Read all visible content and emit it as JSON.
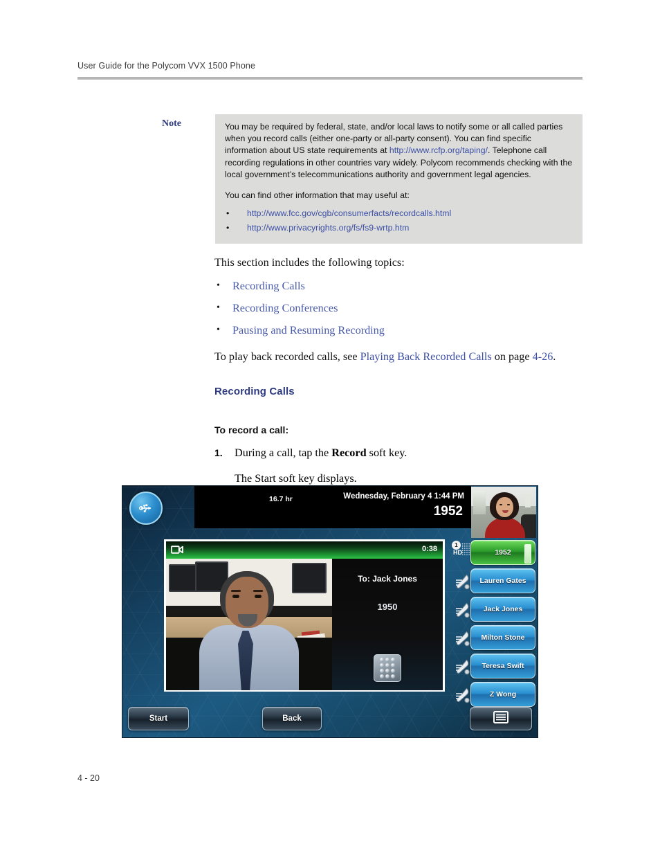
{
  "header": {
    "running_head": "User Guide for the Polycom VVX 1500 Phone"
  },
  "note": {
    "label": "Note",
    "paragraph1_part1": "You may be required by federal, state, and/or local laws to notify some or all called parties when you record calls (either one-party or all-party consent). You can find specific information about US state requirements at ",
    "paragraph1_link": "http://www.rcfp.org/taping/",
    "paragraph1_part2": ". Telephone call recording regulations in other countries vary widely. Polycom recommends checking with the local government’s telecommunications authority and government legal agencies.",
    "paragraph2": "You can find other information that may useful at:",
    "links": [
      "http://www.fcc.gov/cgb/consumerfacts/recordcalls.html",
      "http://www.privacyrights.org/fs/fs9-wrtp.htm"
    ]
  },
  "body": {
    "intro": "This section includes the following topics:",
    "topics": [
      "Recording Calls",
      "Recording Conferences",
      "Pausing and Resuming Recording"
    ],
    "playback_pre": "To play back recorded calls, see ",
    "playback_link": "Playing Back Recorded Calls",
    "playback_mid": " on page ",
    "playback_page": "4-26",
    "playback_post": ".",
    "section_heading": "Recording Calls",
    "procedure_heading": "To record a call:",
    "step1_number": "1.",
    "step1_pre": "During a call, tap the ",
    "step1_bold": "Record",
    "step1_post": " soft key.",
    "step1_result": "The Start soft key displays."
  },
  "phone": {
    "status": {
      "usb_icon": "usb-icon",
      "uptime": "16.7 hr",
      "datetime": "Wednesday, February 4  1:44 PM",
      "extension": "1952",
      "selfview_icon": "self-view-thumbnail"
    },
    "call": {
      "video_icon": "video-camera-icon",
      "duration": "0:38",
      "to_label": "To: Jack Jones",
      "to_number": "1950",
      "dialpad_icon": "dialpad-icon"
    },
    "line_keys": [
      {
        "label": "1952",
        "state": "active",
        "icon": "hd-audio-icon",
        "index_badge": "1",
        "hd_label": "HD"
      },
      {
        "label": "Lauren Gates",
        "state": "idle",
        "icon": "handset-icon"
      },
      {
        "label": "Jack Jones",
        "state": "idle",
        "icon": "handset-icon"
      },
      {
        "label": "Milton Stone",
        "state": "idle",
        "icon": "handset-icon"
      },
      {
        "label": "Teresa Swift",
        "state": "idle",
        "icon": "handset-icon"
      },
      {
        "label": "Z Wong",
        "state": "idle",
        "icon": "handset-icon"
      }
    ],
    "soft_keys": {
      "start": "Start",
      "back": "Back",
      "menu_icon": "menu-list-icon"
    }
  },
  "footer": {
    "page_number": "4 - 20"
  },
  "colors": {
    "link": "#3c4fa5",
    "heading": "#2e3b80",
    "note_bg": "#dcdcda",
    "rule": "#b5b5b5",
    "active_line": "#2a9b2a"
  }
}
